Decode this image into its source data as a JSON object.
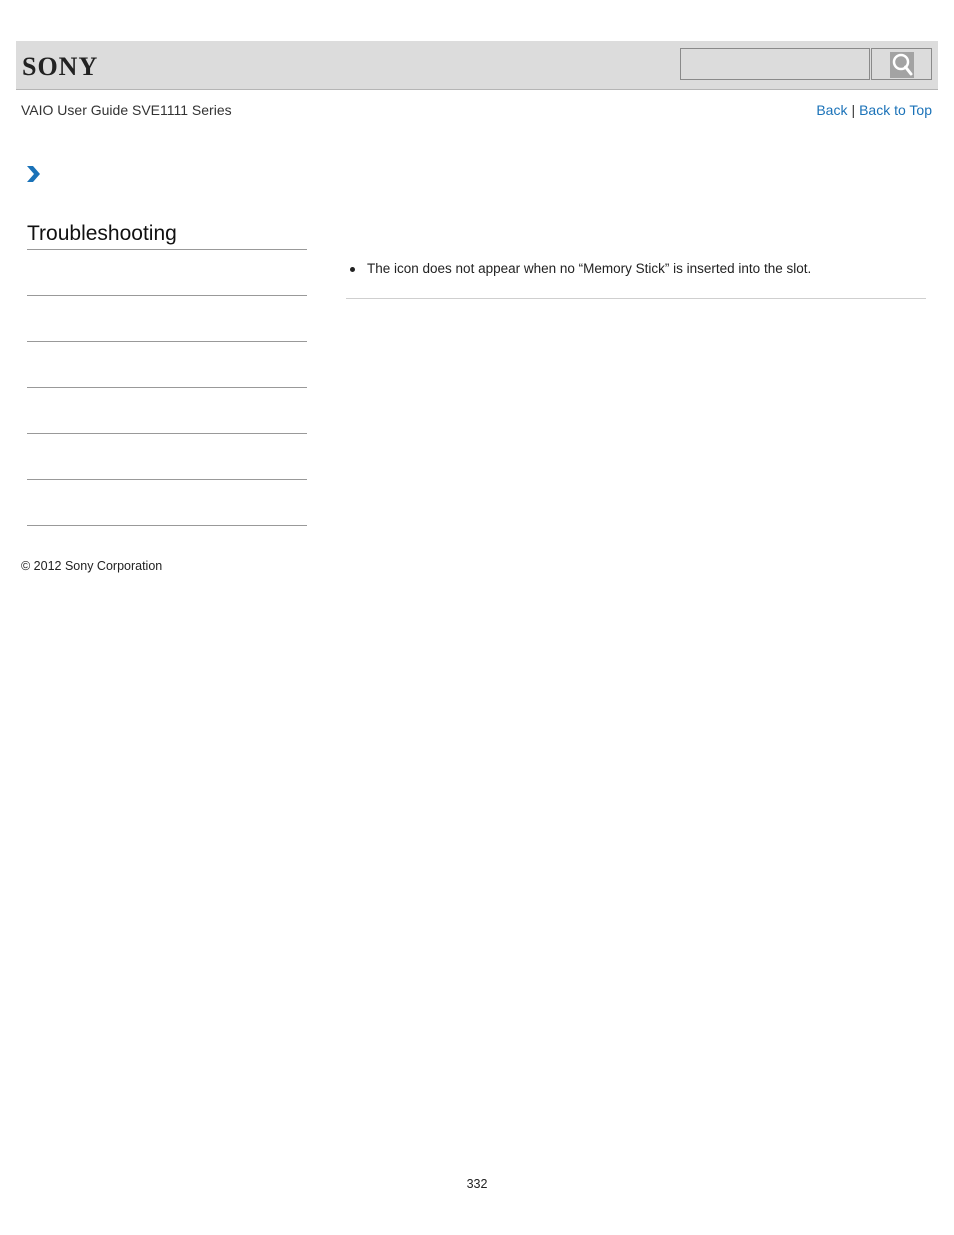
{
  "header": {
    "logo_text": "SONY",
    "search": {
      "value": "",
      "placeholder": ""
    },
    "search_button_icon": "search-icon"
  },
  "subheader": {
    "guide_title": "VAIO User Guide SVE1111 Series",
    "links": {
      "back": "Back",
      "separator": "|",
      "back_to_top": "Back to Top"
    }
  },
  "breadcrumb": {
    "icon": "chevron-right-icon",
    "color": "#1a72b8"
  },
  "sidebar": {
    "title": "Troubleshooting",
    "items": [
      "",
      "",
      "",
      "",
      "",
      ""
    ]
  },
  "content": {
    "bullets": [
      "The icon does not appear when no “Memory Stick” is inserted into the slot."
    ]
  },
  "footer": {
    "copyright": "© 2012 Sony Corporation",
    "page_number": "332"
  }
}
